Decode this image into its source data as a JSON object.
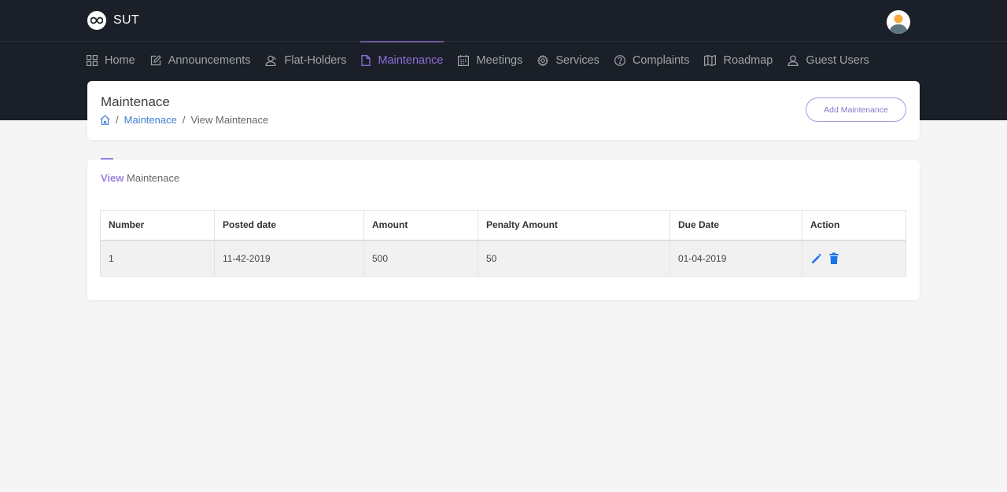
{
  "brand": {
    "name": "SUT",
    "logo_icon": "infinity-icon"
  },
  "user": {
    "avatar_icon": "user-avatar-icon"
  },
  "nav": {
    "items": [
      {
        "label": "Home",
        "icon": "grid-icon",
        "active": false
      },
      {
        "label": "Announcements",
        "icon": "edit-icon",
        "active": false
      },
      {
        "label": "Flat-Holders",
        "icon": "users-icon",
        "active": false
      },
      {
        "label": "Maintenance",
        "icon": "file-icon",
        "active": true
      },
      {
        "label": "Meetings",
        "icon": "calendar-icon",
        "active": false
      },
      {
        "label": "Services",
        "icon": "gear-icon",
        "active": false
      },
      {
        "label": "Complaints",
        "icon": "help-circle-icon",
        "active": false
      },
      {
        "label": "Roadmap",
        "icon": "map-icon",
        "active": false
      },
      {
        "label": "Guest Users",
        "icon": "user-icon",
        "active": false
      }
    ]
  },
  "header": {
    "title": "Maintenace",
    "breadcrumb": {
      "home_icon": "home-icon",
      "separator": "/",
      "link": "Maintenace",
      "current": "View Maintenace"
    },
    "add_button": "Add Maintenance"
  },
  "section": {
    "title_strong": "View",
    "title_rest": "Maintenace"
  },
  "table": {
    "columns": [
      "Number",
      "Posted date",
      "Amount",
      "Penalty Amount",
      "Due Date",
      "Action"
    ],
    "rows": [
      {
        "number": "1",
        "posted_date": "11-42-2019",
        "amount": "500",
        "penalty_amount": "50",
        "due_date": "01-04-2019",
        "actions": [
          "edit-icon",
          "delete-icon"
        ]
      }
    ]
  },
  "colors": {
    "accent": "#8d6fd8",
    "link": "#3f7fd6",
    "action_icon": "#1a73e8",
    "header_bg": "#1b1f28"
  }
}
